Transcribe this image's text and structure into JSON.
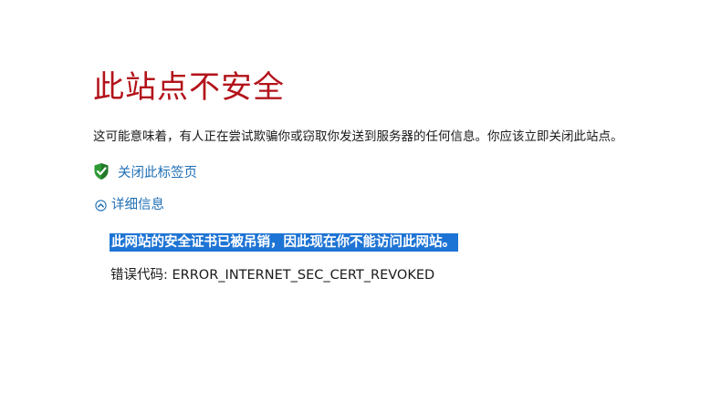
{
  "title": "此站点不安全",
  "warning_text": "这可能意味着，有人正在尝试欺骗你或窃取你发送到服务器的任何信息。你应该立即关闭此站点。",
  "close_link": {
    "label": "关闭此标签页",
    "icon": "green-shield-check-icon"
  },
  "details_toggle": {
    "label": "详细信息",
    "icon": "chevron-up-circle-icon",
    "expanded": true
  },
  "details": {
    "message": "此网站的安全证书已被吊销，因此现在你不能访问此网站。",
    "error_code": "错误代码: ERROR_INTERNET_SEC_CERT_REVOKED"
  },
  "colors": {
    "title": "#b3131b",
    "link": "#1f6fb5",
    "selection": "#1e74d4",
    "shield": "#2e9b35"
  }
}
